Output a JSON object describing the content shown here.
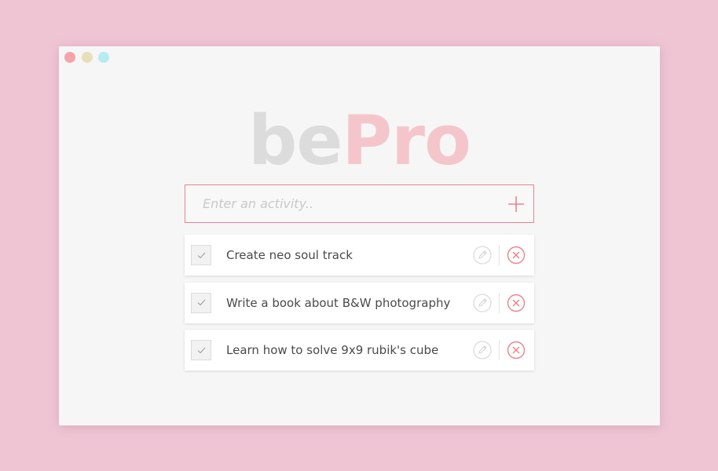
{
  "window": {
    "controls": [
      {
        "name": "close",
        "color": "#f6a4a9"
      },
      {
        "name": "minimize",
        "color": "#e6dfba"
      },
      {
        "name": "maximize",
        "color": "#b6ecf1"
      }
    ]
  },
  "logo": {
    "part1": "be",
    "part2": "Pro",
    "part1_color": "#dcdcdc",
    "part2_color": "#f4c6cc"
  },
  "entry": {
    "placeholder": "Enter an activity..",
    "value": "",
    "add_icon": "plus-icon"
  },
  "colors": {
    "background": "#efc5d4",
    "accent": "#e9828d"
  },
  "tasks": [
    {
      "text": "Create neo soul track"
    },
    {
      "text": "Write a book about B&W photography"
    },
    {
      "text": "Learn how to solve 9x9 rubik's cube"
    }
  ],
  "icons": {
    "check": "check-icon",
    "edit": "pencil-icon",
    "delete": "close-circle-icon"
  }
}
